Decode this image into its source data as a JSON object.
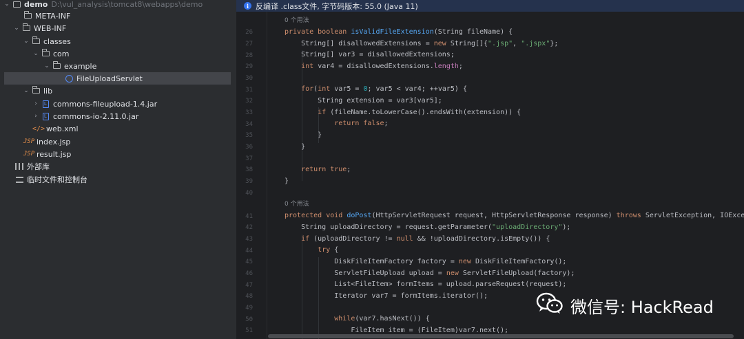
{
  "tree": {
    "root": {
      "name": "demo",
      "path": "D:\\vul_analysis\\tomcat8\\webapps\\demo"
    },
    "items": [
      {
        "label": "META-INF"
      },
      {
        "label": "WEB-INF"
      },
      {
        "label": "classes"
      },
      {
        "label": "com"
      },
      {
        "label": "example"
      },
      {
        "label": "FileUploadServlet"
      },
      {
        "label": "lib"
      },
      {
        "label": "commons-fileupload-1.4.jar"
      },
      {
        "label": "commons-io-2.11.0.jar"
      },
      {
        "label": "web.xml"
      },
      {
        "label": "index.jsp"
      },
      {
        "label": "result.jsp"
      },
      {
        "label": "外部库"
      },
      {
        "label": "临时文件和控制台"
      }
    ]
  },
  "editor": {
    "banner": "反编译 .class文件, 字节码版本: 55.0 (Java 11)",
    "usage_hint_1": "0 个用法",
    "usage_hint_2": "0 个用法",
    "line_numbers": [
      "26",
      "27",
      "28",
      "29",
      "30",
      "31",
      "32",
      "33",
      "34",
      "35",
      "36",
      "37",
      "38",
      "39",
      "40",
      "41",
      "42",
      "43",
      "44",
      "45",
      "46",
      "47",
      "48",
      "49",
      "50",
      "51"
    ]
  },
  "watermark": {
    "text": "微信号: HackRead"
  },
  "colors": {
    "keyword": "#cf8e6d",
    "function": "#56a8f5",
    "string": "#6aab73",
    "number": "#2aacb8",
    "field": "#c77dbb",
    "banner": "#25324d"
  }
}
